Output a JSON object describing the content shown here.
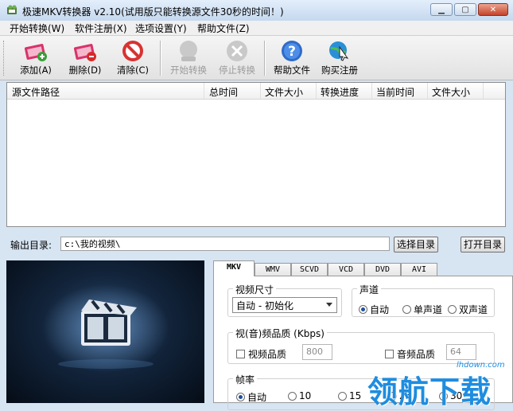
{
  "window": {
    "title": "极速MKV转换器 v2.10(试用版只能转换源文件30秒的时间！)"
  },
  "menu": [
    {
      "label": "开始转换(W)"
    },
    {
      "label": "软件注册(X)"
    },
    {
      "label": "选项设置(Y)"
    },
    {
      "label": "帮助文件(Z)"
    }
  ],
  "toolbar": {
    "add": "添加(A)",
    "delete": "删除(D)",
    "clear": "清除(C)",
    "start": "开始转换",
    "stop": "停止转换",
    "help": "帮助文件",
    "buy": "购买注册"
  },
  "list": {
    "columns": [
      "源文件路径",
      "总时间",
      "文件大小",
      "转换进度",
      "当前时间",
      "文件大小"
    ],
    "rows": []
  },
  "output": {
    "label": "输出目录:",
    "value": "c:\\我的视频\\",
    "select_btn": "选择目录",
    "open_btn": "打开目录"
  },
  "tabs": [
    {
      "label": "MKV",
      "active": true
    },
    {
      "label": "WMV"
    },
    {
      "label": "SCVD"
    },
    {
      "label": "VCD"
    },
    {
      "label": "DVD"
    },
    {
      "label": "AVI"
    }
  ],
  "video_size": {
    "title": "视频尺寸",
    "selected": "自动 - 初始化"
  },
  "channel": {
    "title": "声道",
    "options": [
      "自动",
      "单声道",
      "双声道"
    ],
    "selected": 0
  },
  "quality": {
    "title": "视(音)频品质 (Kbps)",
    "video_label": "视频品质",
    "video_value": "800",
    "audio_label": "音频品质",
    "audio_value": "64"
  },
  "framerate": {
    "title": "帧率",
    "options": [
      "自动",
      "10",
      "15",
      "25",
      "30"
    ],
    "selected": 0
  },
  "watermark": {
    "text": "领航下载",
    "url": "lhdown.com"
  },
  "colors": {
    "accent": "#1e8de0",
    "titlebar": "#c5d8ee",
    "preview": "#12243b"
  }
}
